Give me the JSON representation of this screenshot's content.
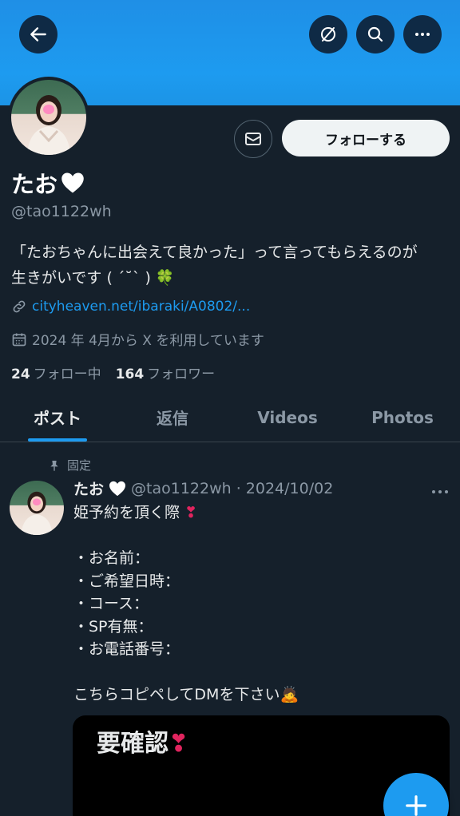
{
  "header": {
    "back_icon": "arrow-left-icon",
    "grok_icon": "slash-circle-icon",
    "search_icon": "search-icon",
    "more_icon": "more-icon"
  },
  "profile": {
    "name": "たお",
    "handle": "@tao1122wh",
    "bio_line1": "「たおちゃんに出会えて良かった」って言ってもらえるのが",
    "bio_line2": "生きがいです ( ´˘` )",
    "bio_emoji": "🍀",
    "link": "cityheaven.net/ibaraki/A0802/...",
    "joined": "2024 年 4月から X を利用しています",
    "following_count": "24",
    "following_label": "フォロー中",
    "followers_count": "164",
    "followers_label": "フォロワー",
    "follow_label": "フォローする"
  },
  "tabs": [
    {
      "label": "ポスト",
      "active": true
    },
    {
      "label": "返信"
    },
    {
      "label": "Videos"
    },
    {
      "label": "Photos"
    }
  ],
  "post": {
    "pinned_label": "固定",
    "name": "たお",
    "handle_date": "@tao1122wh · 2024/10/02",
    "line1": "姫予約を頂く際",
    "line1_mark": "❣",
    "item1": "・お名前：",
    "item2": "・ご希望日時：",
    "item3": "・コース：",
    "item4": "・SP有無：",
    "item5": "・お電話番号：",
    "closing": "こちらコピペしてDMを下さい",
    "closing_emoji": "🙇",
    "media_text": "要確認",
    "media_mark": "❣"
  },
  "colors": {
    "accent": "#1d9bf0",
    "background": "#15202b",
    "muted": "#8b98a5"
  }
}
